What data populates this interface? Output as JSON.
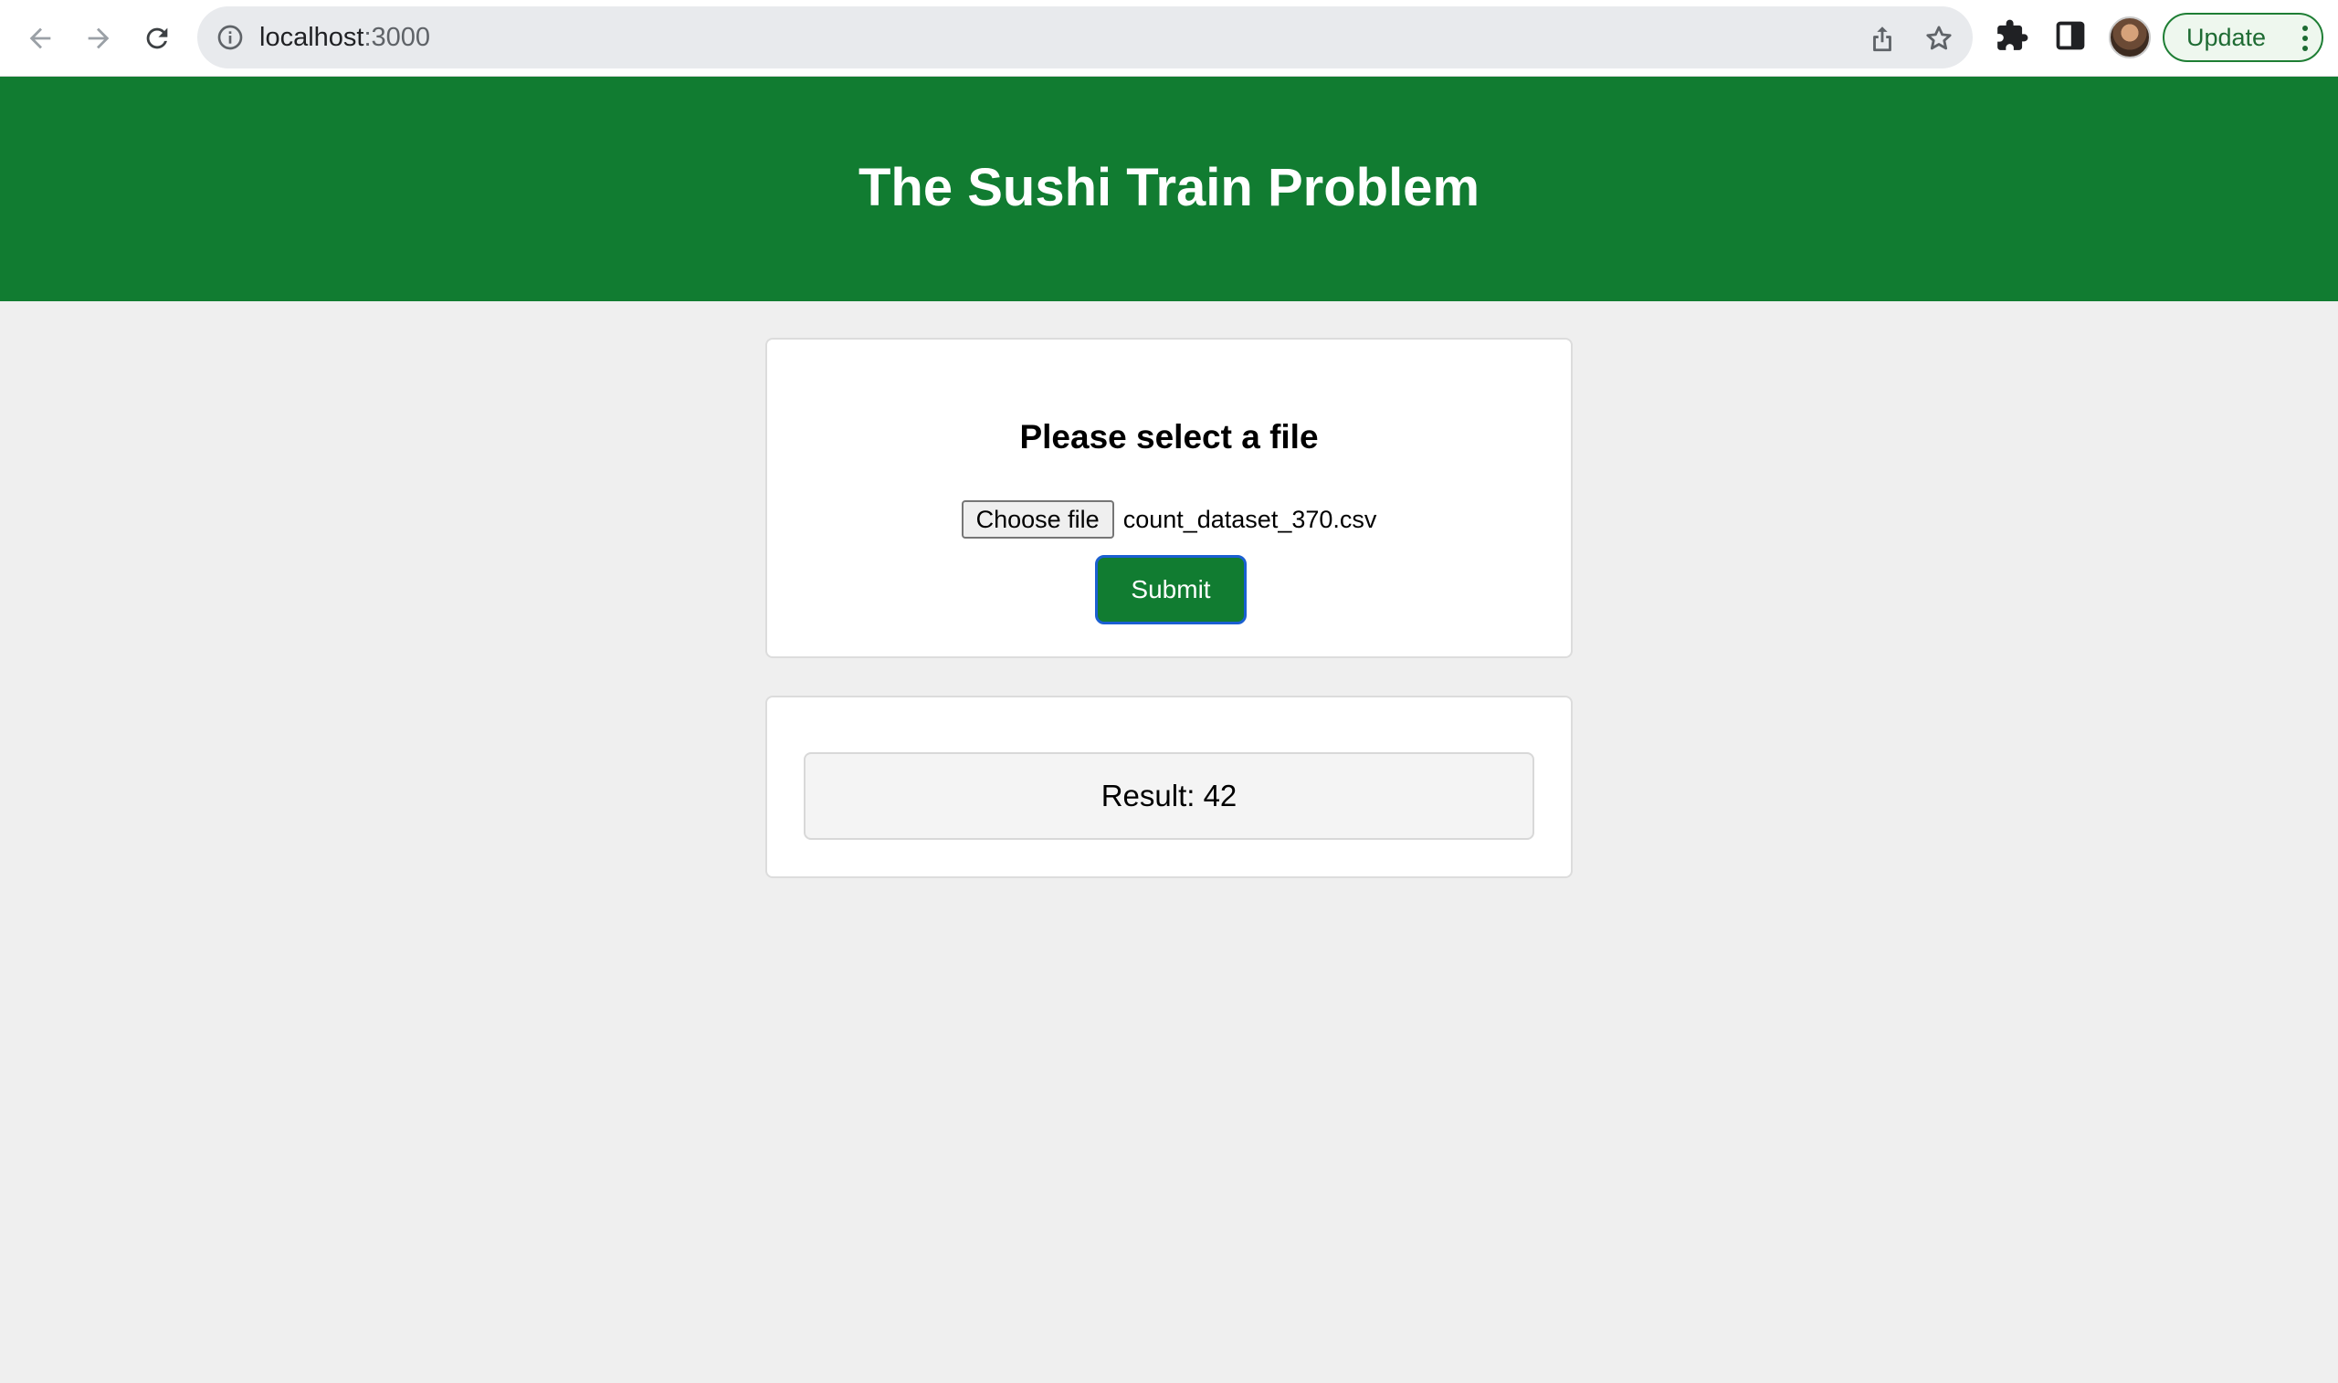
{
  "browser": {
    "url_host": "localhost",
    "url_port": ":3000",
    "update_label": "Update",
    "icons": [
      "back-arrow-icon",
      "forward-arrow-icon",
      "reload-icon",
      "info-icon",
      "share-icon",
      "star-icon",
      "extensions-icon",
      "side-panel-icon",
      "profile-avatar",
      "more-menu-icon"
    ]
  },
  "header": {
    "title": "The Sushi Train Problem"
  },
  "upload": {
    "title": "Please select a file",
    "choose_label": "Choose file",
    "file_name": "count_dataset_370.csv",
    "submit_label": "Submit"
  },
  "result": {
    "text": "Result: 42"
  },
  "colors": {
    "brand_green": "#117c31",
    "page_bg": "#efefef",
    "focus_ring": "#1a5fd1"
  }
}
